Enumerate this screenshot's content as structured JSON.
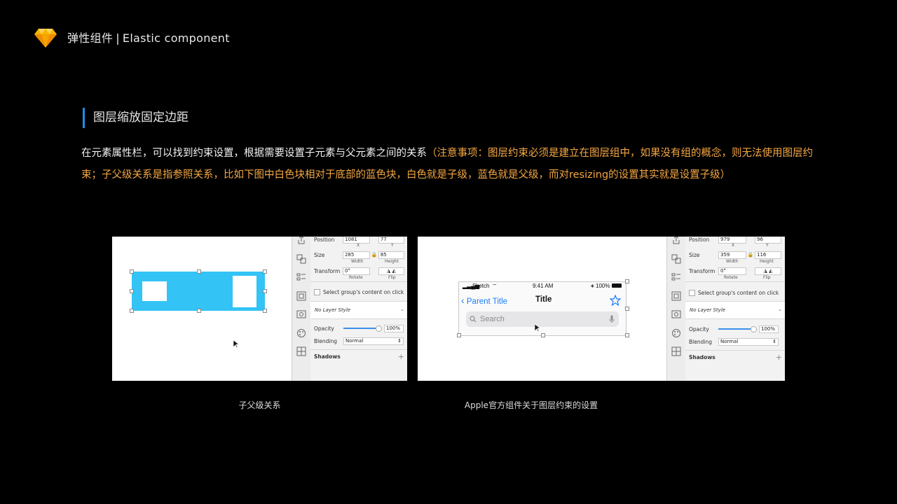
{
  "header": {
    "title_cn": "弹性组件",
    "separator": "|",
    "title_en": "Elastic component"
  },
  "section": {
    "title": "图层缩放固定边距"
  },
  "paragraph": {
    "main": "在元素属性栏，可以找到约束设置，根据需要设置子元素与父元素之间的关系",
    "note": "（注意事项：图层约束必须是建立在图层组中，如果没有组的概念，则无法使用图层约束；子父级关系是指参照关系，比如下图中白色块相对于底部的蓝色块，白色就是子级，蓝色就是父级，而对resizing的设置其实就是设置子级）"
  },
  "captions": {
    "left": "子父级关系",
    "right": "Apple官方组件关于图层约束的设置"
  },
  "inspector_left": {
    "position_label": "Position",
    "pos_x": "1081",
    "pos_y": "77",
    "x_label": "X",
    "y_label": "Y",
    "size_label": "Size",
    "width": "285",
    "height": "85",
    "width_label": "Width",
    "height_label": "Height",
    "transform_label": "Transform",
    "rotate": "0°",
    "rotate_label": "Rotate",
    "flip_label": "Flip",
    "select_group": "Select group's content on click",
    "layer_style": "No Layer Style",
    "opacity_label": "Opacity",
    "opacity": "100%",
    "blending_label": "Blending",
    "blending": "Normal",
    "shadows_label": "Shadows",
    "plus": "+"
  },
  "inspector_right": {
    "position_label": "Position",
    "pos_x": "979",
    "pos_y": "96",
    "x_label": "X",
    "y_label": "Y",
    "size_label": "Size",
    "width": "359",
    "height": "116",
    "width_label": "Width",
    "height_label": "Height",
    "transform_label": "Transform",
    "rotate": "0°",
    "rotate_label": "Rotate",
    "flip_label": "Flip",
    "select_group": "Select group's content on click",
    "layer_style": "No Layer Style",
    "opacity_label": "Opacity",
    "opacity": "100%",
    "blending_label": "Blending",
    "blending": "Normal",
    "shadows_label": "Shadows",
    "plus": "+"
  },
  "phone": {
    "carrier": "Sketch",
    "time": "9:41 AM",
    "battery": "100%",
    "back_label": "Parent Title",
    "title": "Title",
    "search_placeholder": "Search"
  },
  "colors": {
    "accent_blue": "#1e8fe6",
    "note_orange": "#f5a742",
    "rect_blue": "#34c3f5",
    "ios_blue": "#1a7ef7"
  }
}
